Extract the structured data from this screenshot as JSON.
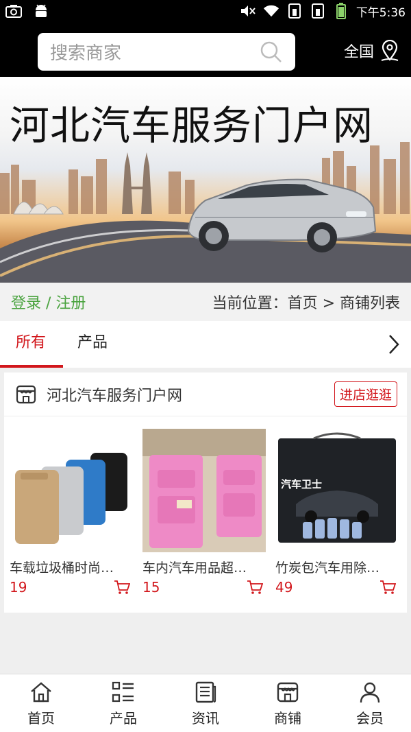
{
  "status_bar": {
    "time": "下午5:36",
    "icons": [
      "camera-icon",
      "android-icon",
      "mute-icon",
      "wifi-icon",
      "sim1-icon",
      "sim2-icon",
      "battery-icon"
    ]
  },
  "search": {
    "placeholder": "搜索商家",
    "region_label": "全国"
  },
  "banner": {
    "title": "河北汽车服务门户网"
  },
  "breadcrumb": {
    "login": "登录 / 注册",
    "location": "当前位置：首页 > 商铺列表"
  },
  "tabs": [
    {
      "label": "所有",
      "active": true
    },
    {
      "label": "产品",
      "active": false
    }
  ],
  "shop": {
    "name": "河北汽车服务门户网",
    "button": "进店逛逛",
    "products": [
      {
        "name": "车载垃圾桶时尚…",
        "price": "19"
      },
      {
        "name": "车内汽车用品超…",
        "price": "15"
      },
      {
        "name": "竹炭包汽车用除…",
        "price": "49"
      }
    ],
    "box_text": "汽车卫士"
  },
  "bottom_nav": [
    {
      "label": "首页",
      "icon": "home-icon"
    },
    {
      "label": "产品",
      "icon": "grid-list-icon"
    },
    {
      "label": "资讯",
      "icon": "news-icon"
    },
    {
      "label": "商铺",
      "icon": "store-icon"
    },
    {
      "label": "会员",
      "icon": "user-icon"
    }
  ],
  "colors": {
    "accent_red": "#d2171c",
    "login_green": "#4aa33f"
  }
}
